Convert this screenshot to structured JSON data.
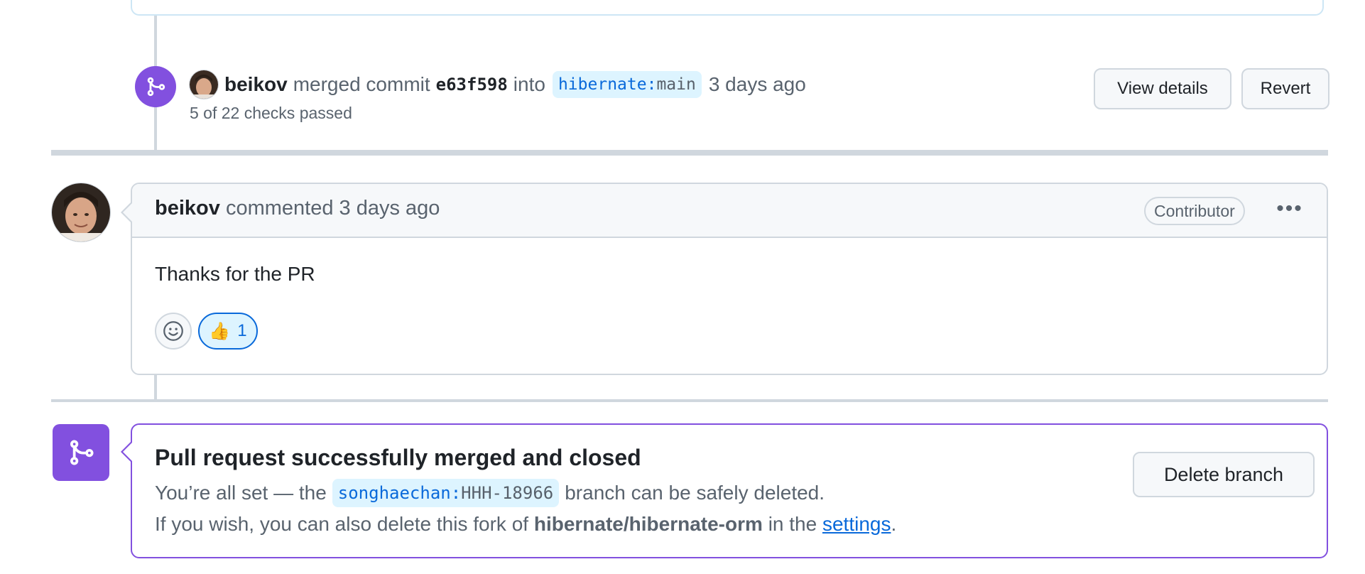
{
  "merge_event": {
    "author": "beikov",
    "action": "merged commit",
    "commit_sha": "e63f598",
    "into": "into",
    "branch_owner": "hibernate:",
    "branch_name": "main",
    "time": "3 days ago",
    "checks": "5 of 22 checks passed",
    "view_details_label": "View details",
    "revert_label": "Revert"
  },
  "comment": {
    "author": "beikov",
    "action": "commented",
    "time": "3 days ago",
    "role_badge": "Contributor",
    "more_label": "•••",
    "body": "Thanks for the PR",
    "reaction_emoji": "👍",
    "reaction_count": "1"
  },
  "merged_box": {
    "title": "Pull request successfully merged and closed",
    "line1_prefix": "You’re all set — the",
    "branch_owner": "songhaechan:",
    "branch_name": "HHH-18966",
    "line1_suffix": "branch can be safely deleted.",
    "line2_prefix": "If you wish, you can also delete this fork of",
    "repo": "hibernate/hibernate-orm",
    "line2_mid": "in the",
    "settings_link": "settings",
    "line2_end": ".",
    "delete_branch_label": "Delete branch"
  },
  "colors": {
    "merged_purple": "#8250df",
    "link_blue": "#0969da",
    "branch_bg": "#ddf4ff",
    "border": "#d0d7de"
  },
  "icons": {
    "merge": "git-merge-icon",
    "smiley": "smiley-icon",
    "more": "kebab-horizontal-icon"
  }
}
